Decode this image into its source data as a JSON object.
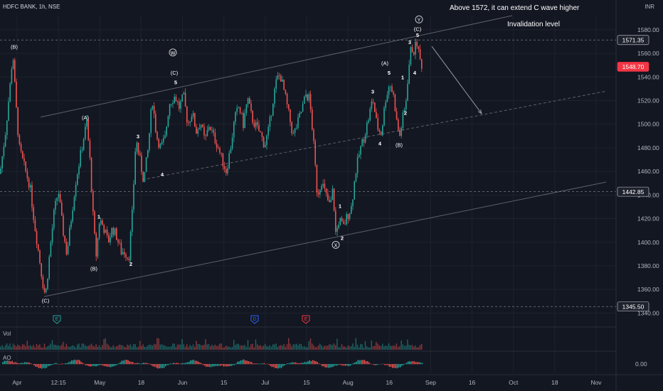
{
  "header": {
    "symbol": "HDFC BANK, 1h, NSE",
    "currency": "INR"
  },
  "annotations": {
    "note1": "Above 1572, it can extend C wave higher",
    "note2": "Invalidation level"
  },
  "panels": {
    "volume": "Vol",
    "ao": "AO",
    "ao_tick": "0.00"
  },
  "colors": {
    "up": "#26a69a",
    "down": "#ef5350",
    "bg": "#131722",
    "grid": "#1e222d",
    "line": "#787b86",
    "label_dark": "#1e222d",
    "label_red": "#f23645"
  },
  "chart_data": {
    "type": "candlestick",
    "title": "HDFC BANK, 1h, NSE",
    "ylim": [
      1333,
      1592
    ],
    "y_ticks": [
      1340,
      1360,
      1380,
      1400,
      1420,
      1440,
      1460,
      1480,
      1500,
      1520,
      1540,
      1560,
      1580
    ],
    "x_tick_labels": [
      "Apr",
      "12:15",
      "May",
      "18",
      "Jun",
      "15",
      "Jul",
      "15",
      "Aug",
      "16",
      "Sep",
      "16",
      "Oct",
      "18",
      "Nov"
    ],
    "price_labels": [
      {
        "value": 1571.35,
        "text": "1571.35",
        "style": "dark"
      },
      {
        "value": 1548.7,
        "text": "1548.70",
        "style": "red"
      },
      {
        "value": 1442.85,
        "text": "1442.85",
        "style": "dark"
      },
      {
        "value": 1345.5,
        "text": "1345.50",
        "style": "dark"
      }
    ],
    "price_path": [
      {
        "x": 0,
        "y": 1458
      },
      {
        "x": 8,
        "y": 1495
      },
      {
        "x": 15,
        "y": 1538
      },
      {
        "x": 18,
        "y": 1562
      },
      {
        "x": 22,
        "y": 1520
      },
      {
        "x": 27,
        "y": 1480
      },
      {
        "x": 35,
        "y": 1462
      },
      {
        "x": 42,
        "y": 1448
      },
      {
        "x": 48,
        "y": 1418
      },
      {
        "x": 55,
        "y": 1388
      },
      {
        "x": 60,
        "y": 1366
      },
      {
        "x": 64,
        "y": 1354
      },
      {
        "x": 70,
        "y": 1392
      },
      {
        "x": 76,
        "y": 1425
      },
      {
        "x": 82,
        "y": 1444
      },
      {
        "x": 88,
        "y": 1412
      },
      {
        "x": 94,
        "y": 1390
      },
      {
        "x": 100,
        "y": 1420
      },
      {
        "x": 106,
        "y": 1450
      },
      {
        "x": 112,
        "y": 1470
      },
      {
        "x": 118,
        "y": 1490
      },
      {
        "x": 122,
        "y": 1502
      },
      {
        "x": 127,
        "y": 1465
      },
      {
        "x": 131,
        "y": 1420
      },
      {
        "x": 135,
        "y": 1388
      },
      {
        "x": 140,
        "y": 1420
      },
      {
        "x": 146,
        "y": 1412
      },
      {
        "x": 152,
        "y": 1400
      },
      {
        "x": 158,
        "y": 1412
      },
      {
        "x": 164,
        "y": 1405
      },
      {
        "x": 170,
        "y": 1392
      },
      {
        "x": 176,
        "y": 1392
      },
      {
        "x": 181,
        "y": 1386
      },
      {
        "x": 186,
        "y": 1425
      },
      {
        "x": 191,
        "y": 1488
      },
      {
        "x": 196,
        "y": 1472
      },
      {
        "x": 202,
        "y": 1452
      },
      {
        "x": 208,
        "y": 1478
      },
      {
        "x": 214,
        "y": 1522
      },
      {
        "x": 220,
        "y": 1490
      },
      {
        "x": 226,
        "y": 1480
      },
      {
        "x": 232,
        "y": 1488
      },
      {
        "x": 238,
        "y": 1518
      },
      {
        "x": 246,
        "y": 1524
      },
      {
        "x": 252,
        "y": 1514
      },
      {
        "x": 258,
        "y": 1524
      },
      {
        "x": 264,
        "y": 1500
      },
      {
        "x": 270,
        "y": 1510
      },
      {
        "x": 276,
        "y": 1494
      },
      {
        "x": 282,
        "y": 1502
      },
      {
        "x": 288,
        "y": 1485
      },
      {
        "x": 294,
        "y": 1500
      },
      {
        "x": 300,
        "y": 1490
      },
      {
        "x": 306,
        "y": 1482
      },
      {
        "x": 312,
        "y": 1470
      },
      {
        "x": 318,
        "y": 1460
      },
      {
        "x": 324,
        "y": 1480
      },
      {
        "x": 330,
        "y": 1505
      },
      {
        "x": 336,
        "y": 1515
      },
      {
        "x": 342,
        "y": 1500
      },
      {
        "x": 348,
        "y": 1522
      },
      {
        "x": 354,
        "y": 1505
      },
      {
        "x": 360,
        "y": 1498
      },
      {
        "x": 366,
        "y": 1492
      },
      {
        "x": 372,
        "y": 1482
      },
      {
        "x": 378,
        "y": 1496
      },
      {
        "x": 384,
        "y": 1522
      },
      {
        "x": 389,
        "y": 1538
      },
      {
        "x": 394,
        "y": 1542
      },
      {
        "x": 400,
        "y": 1526
      },
      {
        "x": 406,
        "y": 1508
      },
      {
        "x": 412,
        "y": 1490
      },
      {
        "x": 418,
        "y": 1500
      },
      {
        "x": 424,
        "y": 1512
      },
      {
        "x": 430,
        "y": 1525
      },
      {
        "x": 435,
        "y": 1522
      },
      {
        "x": 440,
        "y": 1490
      },
      {
        "x": 446,
        "y": 1440
      },
      {
        "x": 452,
        "y": 1452
      },
      {
        "x": 458,
        "y": 1440
      },
      {
        "x": 464,
        "y": 1430
      },
      {
        "x": 468,
        "y": 1445
      },
      {
        "x": 472,
        "y": 1406
      },
      {
        "x": 477,
        "y": 1420
      },
      {
        "x": 482,
        "y": 1412
      },
      {
        "x": 488,
        "y": 1422
      },
      {
        "x": 494,
        "y": 1430
      },
      {
        "x": 500,
        "y": 1460
      },
      {
        "x": 506,
        "y": 1478
      },
      {
        "x": 512,
        "y": 1490
      },
      {
        "x": 518,
        "y": 1505
      },
      {
        "x": 524,
        "y": 1522
      },
      {
        "x": 530,
        "y": 1498
      },
      {
        "x": 536,
        "y": 1492
      },
      {
        "x": 542,
        "y": 1522
      },
      {
        "x": 548,
        "y": 1535
      },
      {
        "x": 554,
        "y": 1522
      },
      {
        "x": 558,
        "y": 1500
      },
      {
        "x": 562,
        "y": 1490
      },
      {
        "x": 566,
        "y": 1505
      },
      {
        "x": 570,
        "y": 1515
      },
      {
        "x": 574,
        "y": 1545
      },
      {
        "x": 578,
        "y": 1565
      },
      {
        "x": 582,
        "y": 1562
      },
      {
        "x": 586,
        "y": 1570
      },
      {
        "x": 590,
        "y": 1555
      },
      {
        "x": 594,
        "y": 1548.7
      }
    ],
    "wave_labels": [
      {
        "x": 20,
        "y": 1564,
        "text": "(B)",
        "circle": false
      },
      {
        "x": 120,
        "y": 1504,
        "text": "(A)",
        "circle": false
      },
      {
        "x": 139,
        "y": 1420,
        "text": "1",
        "circle": false
      },
      {
        "x": 132,
        "y": 1376,
        "text": "(B)",
        "circle": false
      },
      {
        "x": 184,
        "y": 1380,
        "text": "2",
        "circle": false
      },
      {
        "x": 194,
        "y": 1488,
        "text": "3",
        "circle": false
      },
      {
        "x": 228,
        "y": 1456,
        "text": "4",
        "circle": false
      },
      {
        "x": 243,
        "y": 1559,
        "text": "W",
        "circle": true
      },
      {
        "x": 245,
        "y": 1542,
        "text": "(C)",
        "circle": false
      },
      {
        "x": 247,
        "y": 1534,
        "text": "5",
        "circle": false
      },
      {
        "x": 64,
        "y": 1349,
        "text": "(C)",
        "circle": false
      },
      {
        "x": 478,
        "y": 1429,
        "text": "1",
        "circle": false
      },
      {
        "x": 472,
        "y": 1396,
        "text": "X",
        "circle": true
      },
      {
        "x": 481,
        "y": 1402,
        "text": "2",
        "circle": false
      },
      {
        "x": 524,
        "y": 1526,
        "text": "3",
        "circle": false
      },
      {
        "x": 534,
        "y": 1482,
        "text": "4",
        "circle": false
      },
      {
        "x": 541,
        "y": 1550,
        "text": "(A)",
        "circle": false
      },
      {
        "x": 547,
        "y": 1542,
        "text": "5",
        "circle": false
      },
      {
        "x": 561,
        "y": 1481,
        "text": "(B)",
        "circle": false
      },
      {
        "x": 566,
        "y": 1538,
        "text": "1",
        "circle": false
      },
      {
        "x": 570,
        "y": 1508,
        "text": "2",
        "circle": false
      },
      {
        "x": 576,
        "y": 1568,
        "text": "3",
        "circle": false
      },
      {
        "x": 583,
        "y": 1542,
        "text": "4",
        "circle": false
      },
      {
        "x": 589,
        "y": 1587,
        "text": "Y",
        "circle": true
      },
      {
        "x": 587,
        "y": 1579,
        "text": "(C)",
        "circle": false
      },
      {
        "x": 587,
        "y": 1574,
        "text": "5",
        "circle": false
      }
    ],
    "channel_lines": [
      {
        "p1": {
          "x": 57,
          "y": 1506
        },
        "p2": {
          "x": 720,
          "y": 1592
        },
        "style": "solid"
      },
      {
        "p1": {
          "x": 62,
          "y": 1354
        },
        "p2": {
          "x": 852,
          "y": 1451
        },
        "style": "solid"
      },
      {
        "p1": {
          "x": 200,
          "y": 1453
        },
        "p2": {
          "x": 852,
          "y": 1528
        },
        "style": "dashed"
      }
    ],
    "arrow": {
      "from": {
        "x": 607,
        "y": 1566
      },
      "to": {
        "x": 677,
        "y": 1509
      }
    },
    "events": [
      {
        "x": 80,
        "text": "E",
        "color": "#26a69a"
      },
      {
        "x": 358,
        "text": "D",
        "color": "#2962ff"
      },
      {
        "x": 430,
        "text": "E",
        "color": "#f23645"
      }
    ]
  }
}
